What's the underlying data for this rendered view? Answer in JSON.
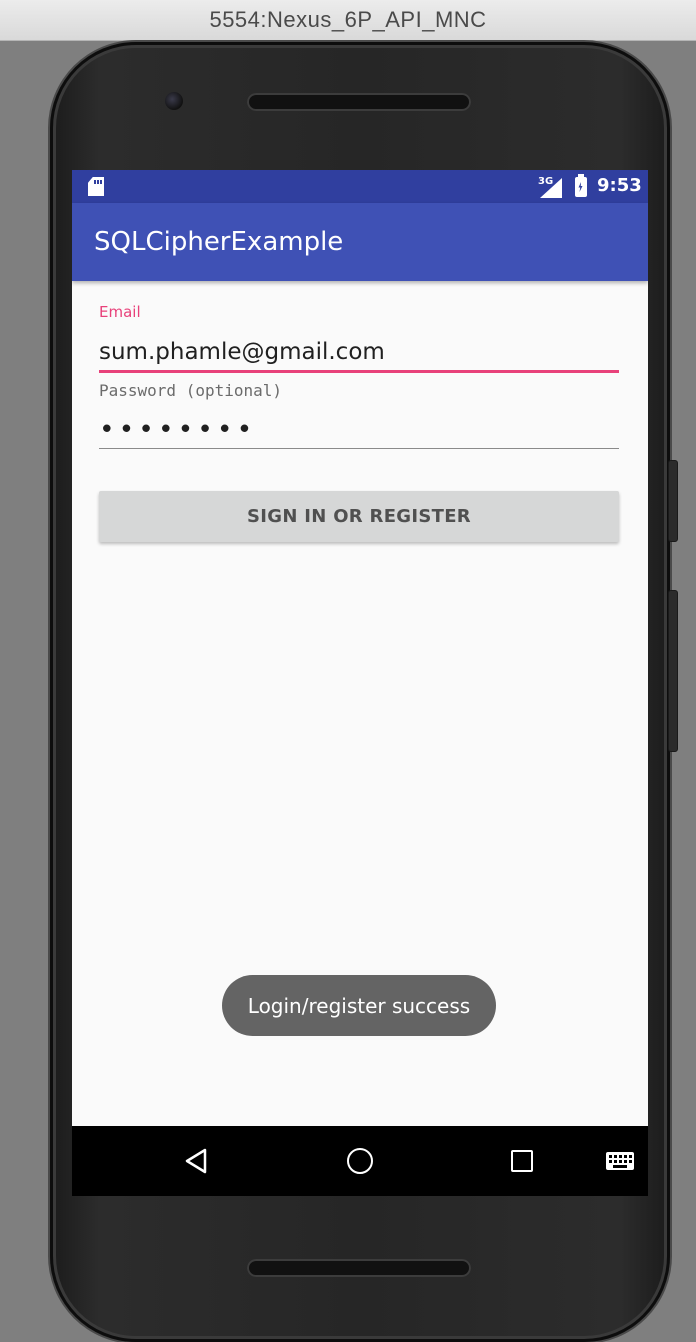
{
  "window": {
    "title": "5554:Nexus_6P_API_MNC"
  },
  "status_bar": {
    "network": "3G",
    "time": "9:53"
  },
  "app_bar": {
    "title": "SQLCipherExample"
  },
  "form": {
    "email_label": "Email",
    "email_value": "sum.phamle@gmail.com",
    "password_label": "Password (optional)",
    "password_value": "pppppppp",
    "submit_label": "SIGN IN OR REGISTER"
  },
  "toast": {
    "message": "Login/register success"
  },
  "nav_bar": {
    "icons": [
      "back-icon",
      "home-icon",
      "recent-apps-icon",
      "keyboard-icon"
    ]
  },
  "colors": {
    "status_bar": "#303f9f",
    "app_bar": "#3f51b5",
    "accent": "#e8417a",
    "button": "#d6d7d7",
    "toast": "#646464"
  }
}
